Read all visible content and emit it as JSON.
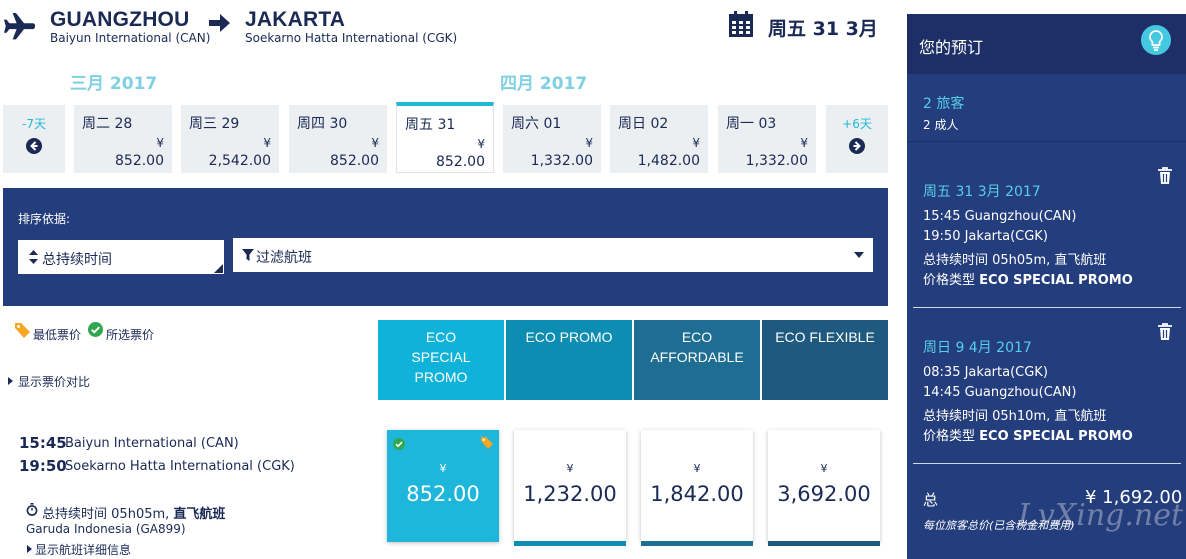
{
  "route": {
    "origin_city": "GUANGZHOU",
    "origin_airport": "Baiyun International (CAN)",
    "dest_city": "JAKARTA",
    "dest_airport": "Soekarno Hatta International (CGK)",
    "selected_date": "周五 31 3月"
  },
  "months": {
    "prev": "三月 2017",
    "current": "四月 2017"
  },
  "date_strip": {
    "prev_label": "-7天",
    "next_label": "+6天",
    "currency": "¥",
    "days": [
      {
        "label": "周二 28",
        "price": "852.00",
        "selected": false
      },
      {
        "label": "周三 29",
        "price": "2,542.00",
        "selected": false
      },
      {
        "label": "周四 30",
        "price": "852.00",
        "selected": false
      },
      {
        "label": "周五 31",
        "price": "852.00",
        "selected": true
      },
      {
        "label": "周六 01",
        "price": "1,332.00",
        "selected": false
      },
      {
        "label": "周日 02",
        "price": "1,482.00",
        "selected": false
      },
      {
        "label": "周一 03",
        "price": "1,332.00",
        "selected": false
      }
    ]
  },
  "filters": {
    "sort_label": "排序依据:",
    "sort_value": "总持续时间",
    "filter_placeholder": "过滤航班"
  },
  "legend": {
    "lowest": "最低票价",
    "selected": "所选票价",
    "compare_link": "显示票价对比"
  },
  "fare_types": [
    {
      "name": "ECO SPECIAL PROMO",
      "color": "#0fb3da"
    },
    {
      "name": "ECO PROMO",
      "color": "#0d8db1"
    },
    {
      "name": "ECO AFFORDABLE",
      "color": "#1d6e92"
    },
    {
      "name": "ECO FLEXIBLE",
      "color": "#1e5a80"
    }
  ],
  "flight": {
    "depart_time": "15:45",
    "depart_airport": "Baiyun International (CAN)",
    "arrive_time": "19:50",
    "arrive_airport": "Soekarno Hatta International (CGK)",
    "duration_label": "总持续时间",
    "duration": "05h05m",
    "nonstop": "直飞航班",
    "carrier": "Garuda Indonesia (GA899)",
    "details_link": "显示航班详细信息",
    "currency": "¥",
    "prices": [
      "852.00",
      "1,232.00",
      "1,842.00",
      "3,692.00"
    ]
  },
  "booking": {
    "title": "您的预订",
    "passengers": "2 旅客",
    "passenger_detail": "2 成人",
    "legs": [
      {
        "date": "周五 31 3月 2017",
        "depart": "15:45 Guangzhou(CAN)",
        "arrive": "19:50 Jakarta(CGK)",
        "duration": "总持续时间 05h05m, 直飞航班",
        "fare_label": "价格类型",
        "fare": "ECO SPECIAL PROMO"
      },
      {
        "date": "周日 9 4月 2017",
        "depart": "08:35 Jakarta(CGK)",
        "arrive": "14:45 Guangzhou(CAN)",
        "duration": "总持续时间 05h10m, 直飞航班",
        "fare_label": "价格类型",
        "fare": "ECO SPECIAL PROMO"
      }
    ],
    "total_label": "总",
    "total_amount": "¥ 1,692.00",
    "total_note": "每位旅客总价(已含税金和费用)",
    "watermark": "LvXing.net"
  }
}
